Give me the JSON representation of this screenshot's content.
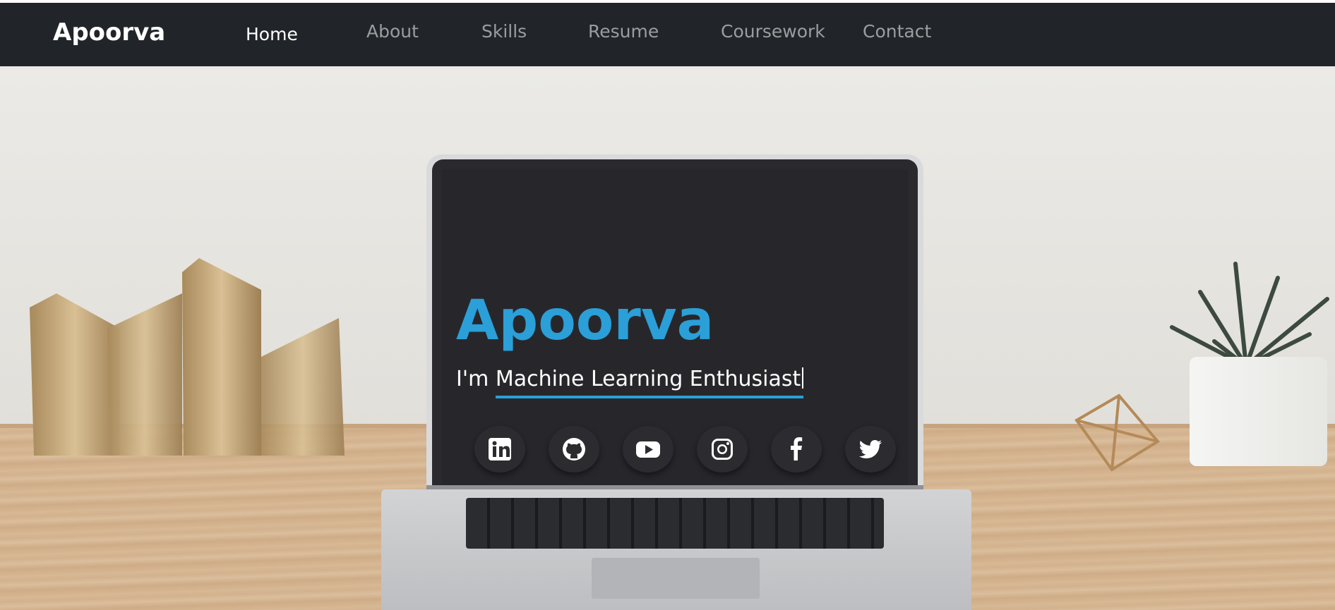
{
  "navbar": {
    "brand": "Apoorva",
    "links": [
      {
        "label": "Home",
        "active": true
      },
      {
        "label": "About",
        "active": false
      },
      {
        "label": "Skills",
        "active": false
      },
      {
        "label": "Resume",
        "active": false
      },
      {
        "label": "Coursework",
        "active": false
      },
      {
        "label": "Contact",
        "active": false
      }
    ]
  },
  "hero": {
    "name": "Apoorva",
    "prefix": "I'm",
    "typed_text": "Machine Learning Enthusiast"
  },
  "socials": [
    {
      "icon": "linkedin-icon"
    },
    {
      "icon": "github-icon"
    },
    {
      "icon": "youtube-icon"
    },
    {
      "icon": "instagram-icon"
    },
    {
      "icon": "facebook-icon"
    },
    {
      "icon": "twitter-icon"
    }
  ],
  "colors": {
    "navbar_bg": "#212529",
    "accent": "#2b9fd8"
  }
}
